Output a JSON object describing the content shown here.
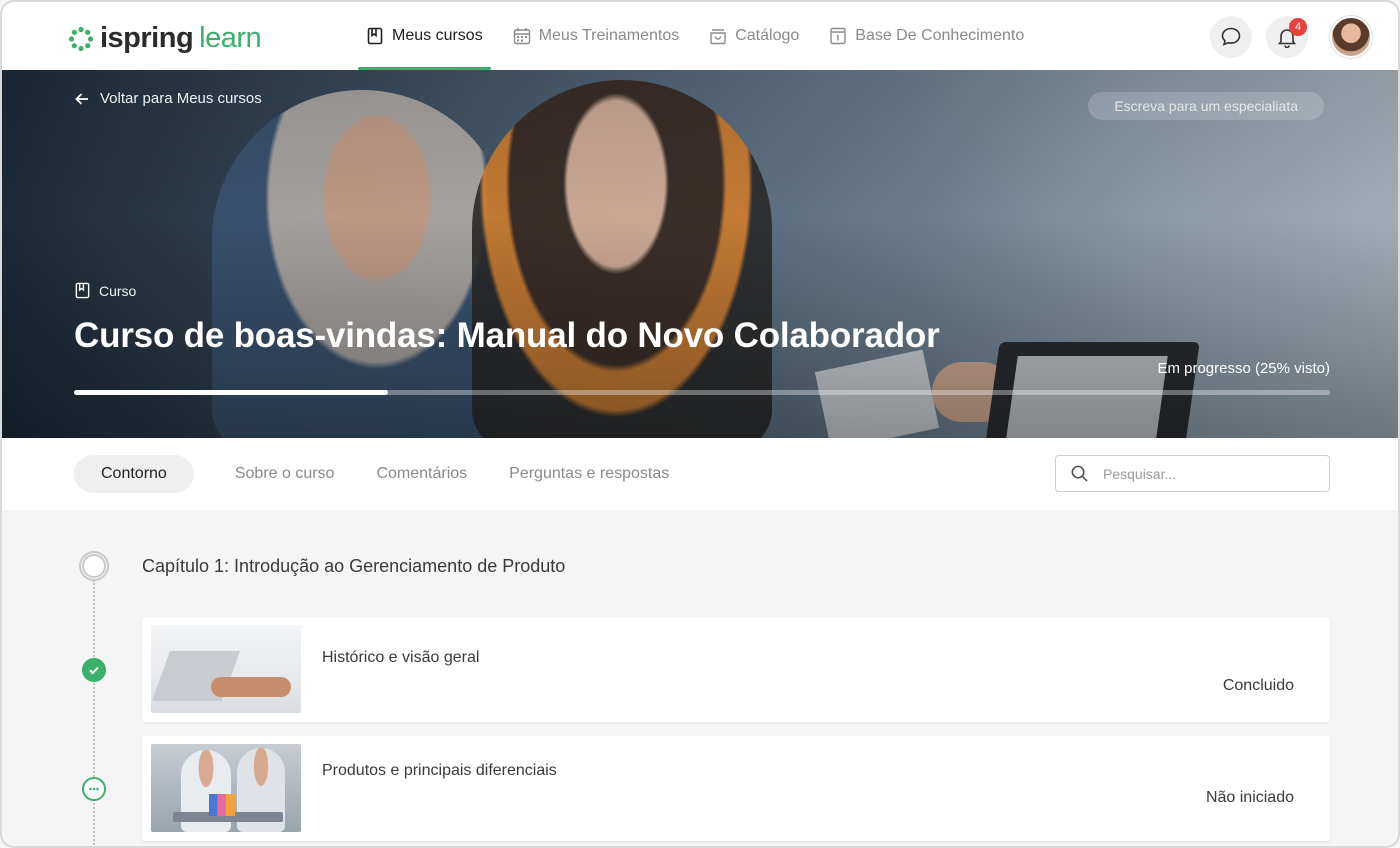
{
  "app": {
    "logo_part1": "ispring",
    "logo_part2": "learn",
    "accent_color": "#3bb06b"
  },
  "nav": {
    "items": [
      {
        "label": "Meus cursos",
        "icon": "book-icon",
        "active": true
      },
      {
        "label": "Meus Treinamentos",
        "icon": "calendar-icon",
        "active": false
      },
      {
        "label": "Catálogo",
        "icon": "basket-icon",
        "active": false
      },
      {
        "label": "Base De Conhecimento",
        "icon": "info-book-icon",
        "active": false
      }
    ],
    "notifications_count": "4"
  },
  "hero": {
    "back_label": "Voltar para Meus cursos",
    "expert_label": "Escreva para um especialiata",
    "type_label": "Curso",
    "title": "Curso de boas-vindas: Manual do Novo Colaborador",
    "progress_label": "Em progresso (25% visto)",
    "progress_fraction": 0.25
  },
  "tabs": [
    {
      "label": "Contorno",
      "active": true
    },
    {
      "label": "Sobre o curso",
      "active": false
    },
    {
      "label": "Comentários",
      "active": false
    },
    {
      "label": "Perguntas e respostas",
      "active": false
    }
  ],
  "search": {
    "placeholder": "Pesquisar..."
  },
  "outline": {
    "chapter_title": "Capítulo 1: Introdução ao Gerenciamento de Produto",
    "lessons": [
      {
        "title": "Histórico e visão geral",
        "status": "Concluido",
        "state": "done"
      },
      {
        "title": "Produtos e principais diferenciais",
        "status": "Não iniciado",
        "state": "pending"
      }
    ]
  }
}
